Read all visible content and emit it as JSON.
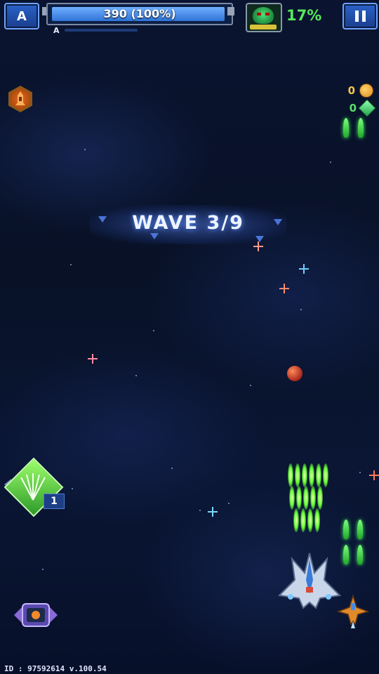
{
  "hud": {
    "rank_button_label": "A",
    "health_text": "390 (100%)",
    "health_fraction": 1.0,
    "sub_rank_label": "A",
    "sub_progress_fraction": 0.0,
    "boss_percent": "17%",
    "pause_icon": "pause-icon"
  },
  "counters": {
    "coins": "0",
    "gems": "0"
  },
  "wave": {
    "text": "WAVE 3/9"
  },
  "skills": {
    "power_shot_count": "1",
    "power_shot_icon": "green-burst-icon",
    "missile_powerup_icon": "missile-icon",
    "shield_gadget_icon": "shield-gadget-icon"
  },
  "footer": {
    "build_id": "ID : 97592614 v.100.54"
  },
  "colors": {
    "accent_blue": "#2a63c9",
    "boss_green": "#57e85a",
    "coin_gold": "#f5c44a"
  }
}
